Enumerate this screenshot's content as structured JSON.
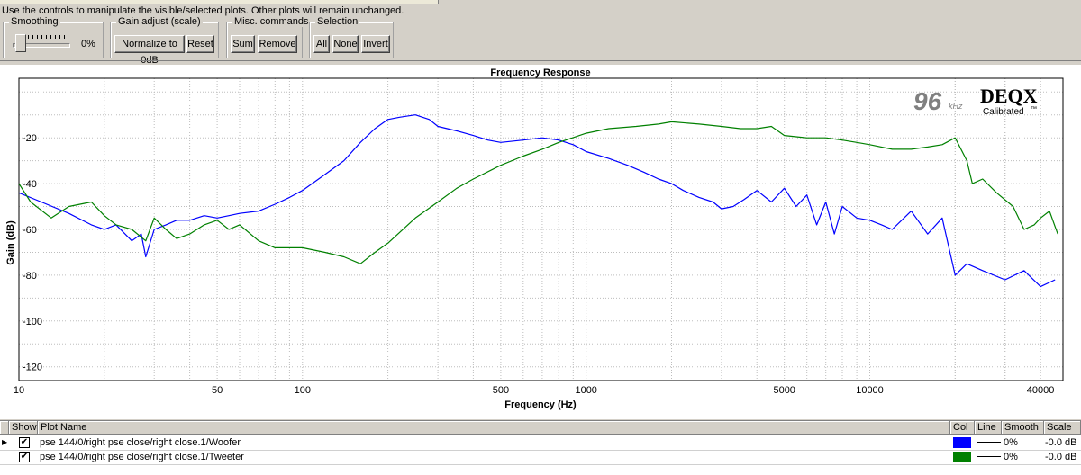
{
  "instructions": "Use the controls to manipulate the visible/selected plots.  Other plots will remain unchanged.",
  "toolbar": {
    "smoothing": {
      "label": "Smoothing",
      "value": "0%",
      "level": 0
    },
    "gain": {
      "label": "Gain adjust (scale)",
      "normalize": "Normalize to 0dB",
      "reset": "Reset"
    },
    "misc": {
      "label": "Misc. commands",
      "sum": "Sum",
      "remove": "Remove"
    },
    "selection": {
      "label": "Selection",
      "all": "All",
      "none": "None",
      "invert": "Invert"
    }
  },
  "badge": {
    "rate": "96",
    "unit": "kHz",
    "brand": "DEQX",
    "tag": "Calibrated",
    "tm": "™"
  },
  "chart_data": {
    "type": "line",
    "title": "Frequency Response",
    "xlabel": "Frequency (Hz)",
    "ylabel": "Gain (dB)",
    "xscale": "log",
    "xlim": [
      10,
      48000
    ],
    "ylim": [
      -126,
      6
    ],
    "xticks": [
      "10",
      "50",
      "100",
      "500",
      "1000",
      "5000",
      "10000",
      "40000"
    ],
    "yticks": [
      "-20",
      "-40",
      "-60",
      "-80",
      "-100",
      "-120"
    ],
    "grid": true,
    "series": [
      {
        "name": "pse 144/0/right pse close/right close.1/Woofer",
        "color": "#0000ff",
        "x": [
          10,
          12,
          15,
          18,
          20,
          22,
          25,
          27,
          28,
          30,
          33,
          36,
          40,
          45,
          50,
          55,
          60,
          70,
          80,
          90,
          100,
          120,
          140,
          160,
          180,
          200,
          220,
          250,
          280,
          300,
          350,
          400,
          450,
          500,
          600,
          700,
          800,
          900,
          1000,
          1200,
          1400,
          1600,
          1800,
          2000,
          2200,
          2500,
          2800,
          3000,
          3300,
          3600,
          4000,
          4500,
          5000,
          5500,
          6000,
          6500,
          7000,
          7500,
          8000,
          9000,
          10000,
          11000,
          12000,
          14000,
          16000,
          18000,
          20000,
          22000,
          25000,
          30000,
          35000,
          40000,
          45000
        ],
        "y": [
          -44,
          -48,
          -53,
          -58,
          -60,
          -58,
          -65,
          -62,
          -72,
          -60,
          -58,
          -56,
          -56,
          -54,
          -55,
          -54,
          -53,
          -52,
          -49,
          -46,
          -43,
          -36,
          -30,
          -22,
          -16,
          -12,
          -11,
          -10,
          -12,
          -15,
          -17,
          -19,
          -21,
          -22,
          -21,
          -20,
          -21,
          -23,
          -26,
          -29,
          -32,
          -35,
          -38,
          -40,
          -43,
          -46,
          -48,
          -51,
          -50,
          -47,
          -43,
          -48,
          -42,
          -50,
          -45,
          -58,
          -48,
          -62,
          -50,
          -55,
          -56,
          -58,
          -60,
          -52,
          -62,
          -55,
          -80,
          -75,
          -78,
          -82,
          -78,
          -85,
          -82
        ]
      },
      {
        "name": "pse 144/0/right pse close/right close.1/Tweeter",
        "color": "#008000",
        "x": [
          10,
          11,
          13,
          15,
          18,
          20,
          22,
          25,
          28,
          30,
          33,
          36,
          40,
          45,
          50,
          55,
          60,
          70,
          80,
          100,
          120,
          140,
          160,
          180,
          200,
          250,
          300,
          350,
          400,
          500,
          600,
          700,
          800,
          1000,
          1200,
          1500,
          1800,
          2000,
          2500,
          3000,
          3500,
          4000,
          4500,
          5000,
          6000,
          7000,
          8000,
          9000,
          10000,
          12000,
          14000,
          16000,
          18000,
          20000,
          22000,
          23000,
          25000,
          28000,
          32000,
          35000,
          38000,
          40000,
          43000,
          46000
        ],
        "y": [
          -40,
          -48,
          -55,
          -50,
          -48,
          -54,
          -58,
          -60,
          -65,
          -55,
          -60,
          -64,
          -62,
          -58,
          -56,
          -60,
          -58,
          -65,
          -68,
          -68,
          -70,
          -72,
          -75,
          -70,
          -66,
          -55,
          -48,
          -42,
          -38,
          -32,
          -28,
          -25,
          -22,
          -18,
          -16,
          -15,
          -14,
          -13,
          -14,
          -15,
          -16,
          -16,
          -15,
          -19,
          -20,
          -20,
          -21,
          -22,
          -23,
          -25,
          -25,
          -24,
          -23,
          -20,
          -30,
          -40,
          -38,
          -44,
          -50,
          -60,
          -58,
          -55,
          -52,
          -62
        ]
      }
    ]
  },
  "plots_table": {
    "headers": {
      "show": "Show",
      "name": "Plot Name",
      "col": "Col",
      "line": "Line",
      "smooth": "Smooth",
      "scale": "Scale"
    },
    "rows": [
      {
        "show": true,
        "name": "pse 144/0/right pse close/right close.1/Woofer",
        "color": "#0000ff",
        "smooth": "0%",
        "scale": "-0.0 dB"
      },
      {
        "show": true,
        "name": "pse 144/0/right pse close/right close.1/Tweeter",
        "color": "#008000",
        "smooth": "0%",
        "scale": "-0.0 dB"
      }
    ]
  }
}
